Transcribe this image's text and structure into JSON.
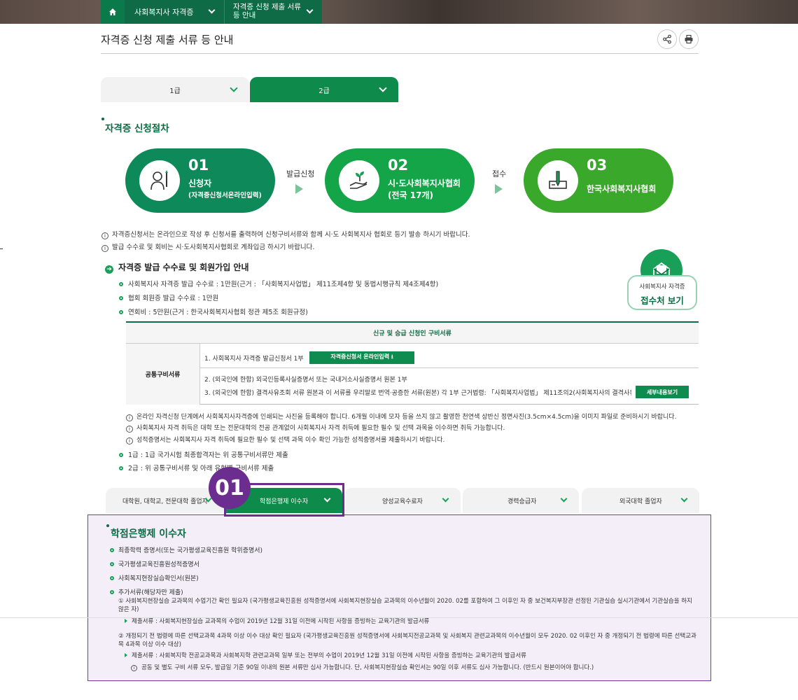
{
  "breadcrumb": {
    "level1": "사회복지사 자격증",
    "level2_line1": "자격증 신청 제출 서류",
    "level2_line2": "등 안내"
  },
  "page_title": "자격증 신청 제출 서류 등 안내",
  "grade_tabs": [
    "1급",
    "2급"
  ],
  "procedure": {
    "title": "자격증 신청절차",
    "steps": [
      {
        "num": "01",
        "line1": "신청자",
        "line2": "(자격증신청서온라인입력)"
      },
      {
        "num": "02",
        "line1": "시·도사회복지사협회",
        "line2": "(전국 17개)"
      },
      {
        "num": "03",
        "line1": "한국사회복지사협회",
        "line2": ""
      }
    ],
    "arrows": [
      "발급신청",
      "접수"
    ],
    "colors": {
      "step1": "#0e8a5a",
      "step2": "#14a548",
      "step3": "#3aa82a"
    }
  },
  "notes": [
    "자격증신청서는 온라인으로 작성 후 신청서를 출력하여 신청구비서류와 함께 시·도 사회복지사 협회로 등기 발송 하시기 바랍니다.",
    "발급 수수료 및 회비는 시·도사회복지사협회로 계좌입금 하시기 바랍니다."
  ],
  "fee": {
    "title": "자격증 발급 수수료 및 회원가입 안내",
    "items": [
      "사회복지사 자격증 발급 수수료 : 1만원(근거 : 「사회복지사업법」 제11조제4항 및 동법시행규칙 제4조제4항)",
      "협회 회원증 발급 수수료 : 1만원",
      "연회비 : 5만원(근거 : 한국사회복지사협회 정관 제5조 회원규정)"
    ]
  },
  "reception": {
    "line1": "사회복지사 자격증",
    "line2": "접수처 보기"
  },
  "docs_table": {
    "header": "신규 및 승급 신청인 구비서류",
    "row_label": "공통구비서류",
    "row1": "1. 사회복지사 자격증 발급신청서 1부",
    "row1_button": "자격증신청서 온라인입력 ⭳",
    "row2": "2. (외국인에 한함) 외국인등록사실증명서 또는 국내거소사실증명서 원본 1부",
    "row3": "3. (외국인에 한함) 결격사유조회 서류 원본과 이 서류를 우리말로 번역·공증한 서류(원본) 각 1부   근거법령: 「사회복지사업법」 제11조의2(사회복지사의 결격사유) →",
    "row3_button": "세부내용보기"
  },
  "table_notes": [
    "온라인 자격신청 단계에서 사회복지사자격증에 인쇄되는 사진을 등록해야 합니다. 6개월 이내에 모자 등을 쓰지 않고 촬영한 천연색 상반신 정면사진(3.5cm×4.5cm)을 이미지 파일로 준비하시기 바랍니다.",
    "사회복지사 자격 취득은 대학 또는 전문대학의 전공 관계없이 사회복지사 자격 취득에 필요한 필수 및 선택 과목을 이수하면 취득 가능합니다.",
    "성적증명서는 사회복지사 자격 취득에 필요한 필수 및 선택 과목 이수 확인 가능한 성적증명서를 제출하시기 바랍니다."
  ],
  "grade_notes": [
    "1급 : 1급 국가시험 최종합격자는 위 공통구비서류만 제출",
    "2급 : 위 공통구비서류 및 아래 유형별 구비서류 제출"
  ],
  "type_tabs": [
    "대학원, 대학교, 전문대학 졸업자",
    "학점은행제 이수자",
    "양성교육수료자",
    "경력승급자",
    "외국대학 졸업자"
  ],
  "highlight_badge": "01",
  "panel": {
    "title": "학점은행제 이수자",
    "items": [
      "최종학력 증명서(또는 국가평생교육진흥원 학위증명서)",
      "국가평생교육진흥원성적증명서",
      "사회복지현장실습확인서(원본)",
      "추가서류(해당자만 제출)"
    ],
    "sub1": "① 사회복지현장실습 교과목의 수업기간 확인 필요자 (국가평생교육진흥원 성적증명서에 사회복지현장실습 교과목의 이수년월이 2020. 02를 포함하여 그 이후인 자 중 보건복지부장관 선정된 기관실습 실시기관에서 기관실습을 하지 않은 자)",
    "sub1_doc": "제출서류 : 사회복지현장실습 교과목의 수업이 2019년 12월 31일 이전에 시작된 사항을 증빙하는 교육기관의 발급서류",
    "sub2": "② 개정되기 전 법령에 따른 선택교과목 4과목 이상 이수 대상 확인 필요자 (국가평생교육진흥원 성적증명서에 사회복지전공교과목 및 사회복지 관련교과목의 이수년월이 모두 2020. 02 이후인 자 중 개정되기 전 법령에 따른 선택교과목 4과목 이상 이수 대상)",
    "sub2_doc": "제출서류 : 사회복지학 전공교과목과 사회복지학 관련교과목 일부 또는 전부의 수업이 2019년 12월 31일 이전에 시작된 사항을 증빙하는 교육기관의 발급서류",
    "footnote": "공동 및 별도 구비 서류 모두, 발급일 기준 90일 이내의 원본 서류만 심사 가능합니다. 단, 사회복지현장실습 확인서는 90일 이후 서류도 심사 가능합니다. (반드시 원본이어야 합니다.)"
  }
}
